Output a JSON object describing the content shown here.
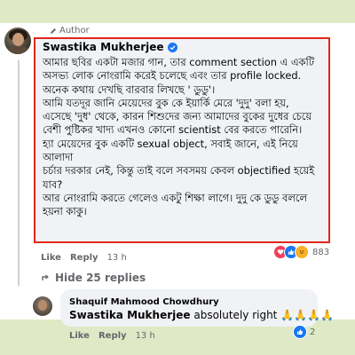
{
  "comment": {
    "author_badge": "Author",
    "author_name": "Swastika Mukherjee",
    "lines": [
      "আমার ছবির একটা মজার গান, তার comment section এ একটি",
      "অসভ্য লোক নোংরামি করেই চলেছে এবং তার profile locked.",
      "অনেক কথায় দেখছি বারবার লিখছে ' ডুডু'।",
      "আমি যতদূর জানি মেয়েদের বুক কে ইয়ার্কি মেরে 'দুদু' বলা হয়,",
      "এসেছে 'দুধ' থেকে, কারন শিশুদের জন্য আমাদের বুকের দুধের চেয়ে",
      "বেশী পুষ্টিকর খাদ্য এখনও কোনো scientist বের করতে পারেনি।",
      "হ্যা মেয়েদের বুক একটি sexual object, সবাই জানে, এই নিয়ে আলাদা",
      "চর্চার দরকার নেই, কিন্তু তাই বলে সবসময় কেবল objectified হয়েই",
      "যাব?",
      "আর নোংরামি করতে গেলেও একটু শিক্ষা লাগে। দুদু কে ডুডু বললে",
      "হয়না কাকু।"
    ],
    "actions": {
      "like": "Like",
      "reply": "Reply",
      "time": "13 h"
    },
    "reaction_count": "883",
    "hide_replies": "Hide 25 replies"
  },
  "reply": {
    "author_name": "Shaquif Mahmood Chowdhury",
    "mention": "Swastika Mukherjee",
    "text": " absolutely right 🙏🙏🙏🙏",
    "actions": {
      "like": "Like",
      "reply": "Reply",
      "time": "13 h"
    },
    "reaction_count": "2"
  },
  "colors": {
    "highlight_border": "#e2261b",
    "facebook_blue": "#1877f2",
    "like_blue": "#1877f2",
    "love_red": "#f33e58",
    "haha_yellow": "#f7b125"
  },
  "icons": {
    "author_badge": "pen-icon",
    "verified": "verified-badge-icon",
    "hide_replies": "arrow-up-right-icon",
    "reactions": [
      "love-icon",
      "like-icon",
      "haha-icon"
    ],
    "reply_reaction": "like-icon"
  }
}
